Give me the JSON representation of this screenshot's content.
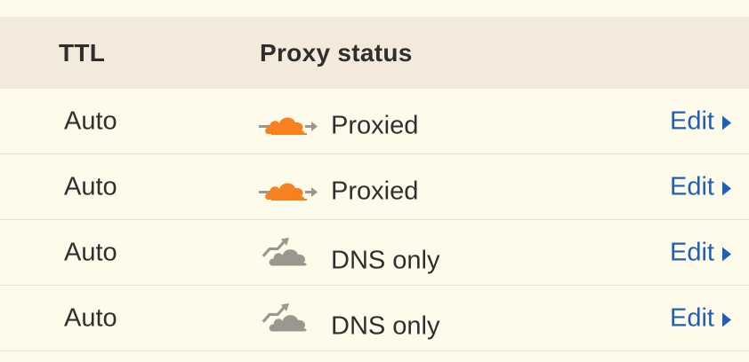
{
  "table": {
    "columns": {
      "ttl": "TTL",
      "proxy_status": "Proxy status"
    },
    "rows": [
      {
        "ttl": "Auto",
        "proxy_status": "Proxied",
        "status_icon": "proxied-cloud-icon",
        "action": "Edit"
      },
      {
        "ttl": "Auto",
        "proxy_status": "Proxied",
        "status_icon": "proxied-cloud-icon",
        "action": "Edit"
      },
      {
        "ttl": "Auto",
        "proxy_status": "DNS only",
        "status_icon": "dns-only-cloud-icon",
        "action": "Edit"
      },
      {
        "ttl": "Auto",
        "proxy_status": "DNS only",
        "status_icon": "dns-only-cloud-icon",
        "action": "Edit"
      }
    ]
  },
  "colors": {
    "background": "#fefbea",
    "header_background": "#f4eadb",
    "proxied_cloud": "#f6821f",
    "dns_only_cloud": "#9b968e",
    "link": "#1f5fb5"
  }
}
